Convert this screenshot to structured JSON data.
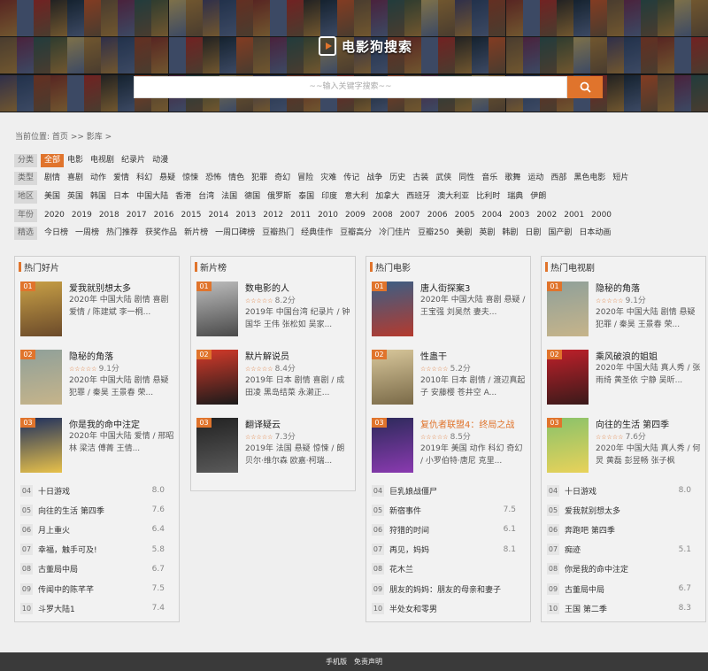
{
  "header": {
    "logo_text": "电影狗搜索",
    "search_placeholder": "~~输入关键字搜索~~"
  },
  "breadcrumb": {
    "prefix": "当前位置:",
    "home": "首页",
    "sep": ">>",
    "current": "影库",
    "tail": ">"
  },
  "filters": [
    {
      "label": "分类",
      "items": [
        "全部",
        "电影",
        "电视剧",
        "纪录片",
        "动漫"
      ],
      "active": 0
    },
    {
      "label": "类型",
      "items": [
        "剧情",
        "喜剧",
        "动作",
        "爱情",
        "科幻",
        "悬疑",
        "惊悚",
        "恐怖",
        "情色",
        "犯罪",
        "奇幻",
        "冒险",
        "灾难",
        "传记",
        "战争",
        "历史",
        "古装",
        "武侠",
        "同性",
        "音乐",
        "歌舞",
        "运动",
        "西部",
        "黑色电影",
        "短片"
      ],
      "active": -1
    },
    {
      "label": "地区",
      "items": [
        "美国",
        "英国",
        "韩国",
        "日本",
        "中国大陆",
        "香港",
        "台湾",
        "法国",
        "德国",
        "俄罗斯",
        "泰国",
        "印度",
        "意大利",
        "加拿大",
        "西班牙",
        "澳大利亚",
        "比利时",
        "瑞典",
        "伊朗"
      ],
      "active": -1
    },
    {
      "label": "年份",
      "items": [
        "2020",
        "2019",
        "2018",
        "2017",
        "2016",
        "2015",
        "2014",
        "2013",
        "2012",
        "2011",
        "2010",
        "2009",
        "2008",
        "2007",
        "2006",
        "2005",
        "2004",
        "2003",
        "2002",
        "2001",
        "2000"
      ],
      "active": -1
    },
    {
      "label": "精选",
      "items": [
        "今日榜",
        "一周榜",
        "热门推荐",
        "获奖作品",
        "新片榜",
        "一周口碑榜",
        "豆瓣热门",
        "经典佳作",
        "豆瓣高分",
        "冷门佳片",
        "豆瓣250",
        "美剧",
        "英剧",
        "韩剧",
        "日剧",
        "国产剧",
        "日本动画"
      ],
      "active": -1
    }
  ],
  "panels": [
    {
      "title": "热门好片",
      "featured": [
        {
          "rank": "01",
          "title": "爱我就别想太多",
          "rating": "",
          "info": "2020年 中国大陆 剧情 喜剧 爱情 / 陈建斌 李一桐...",
          "poster": [
            "#c8a046",
            "#6b4a2a"
          ]
        },
        {
          "rank": "02",
          "title": "隐秘的角落",
          "rating": "9.1分",
          "info": "2020年 中国大陆 剧情 悬疑 犯罪 / 秦昊 王景春 荣...",
          "poster": [
            "#8fa09a",
            "#c6b48a"
          ]
        },
        {
          "rank": "03",
          "title": "你是我的命中注定",
          "rating": "",
          "info": "2020年 中国大陆 爱情 / 邢昭林 梁洁 傅菁 王倩...",
          "poster": [
            "#1e2f5e",
            "#e8c14a"
          ]
        }
      ],
      "list": [
        {
          "num": "04",
          "name": "十日游戏",
          "score": "8.0"
        },
        {
          "num": "05",
          "name": "向往的生活 第四季",
          "score": "7.6"
        },
        {
          "num": "06",
          "name": "月上重火",
          "score": "6.4"
        },
        {
          "num": "07",
          "name": "幸福，触手可及!",
          "score": "5.8"
        },
        {
          "num": "08",
          "name": "古董局中局",
          "score": "6.7"
        },
        {
          "num": "09",
          "name": "传闻中的陈芊芊",
          "score": "7.5"
        },
        {
          "num": "10",
          "name": "斗罗大陆1",
          "score": "7.4"
        }
      ]
    },
    {
      "title": "新片榜",
      "featured": [
        {
          "rank": "01",
          "title": "数电影的人",
          "rating": "8.2分",
          "info": "2019年 中国台湾 纪录片 / 钟国华 王伟 张松如 吴家...",
          "poster": [
            "#bdbdbd",
            "#4a4a4a"
          ]
        },
        {
          "rank": "02",
          "title": "默片解说员",
          "rating": "8.4分",
          "info": "2019年 日本 剧情 喜剧 / 成田凌 黑岛结菜 永濑正...",
          "poster": [
            "#d53a2a",
            "#1a1a1a"
          ]
        },
        {
          "rank": "03",
          "title": "翻译疑云",
          "rating": "7.3分",
          "info": "2019年 法国 悬疑 惊悚 / 朗贝尔·维尔森 欧嘉·柯瑞...",
          "poster": [
            "#222222",
            "#5a5a5a"
          ]
        }
      ],
      "list": []
    },
    {
      "title": "热门电影",
      "featured": [
        {
          "rank": "01",
          "title": "唐人街探案3",
          "rating": "",
          "info": "2020年 中国大陆 喜剧 悬疑 / 王宝强 刘昊然 妻夫...",
          "poster": [
            "#3a5f86",
            "#b43a2e"
          ]
        },
        {
          "rank": "02",
          "title": "性蛊干",
          "rating": "5.2分",
          "info": "2010年 日本 剧情 / 渡辺真起子 安藤樱 苍井空 A...",
          "poster": [
            "#d8c79b",
            "#7a6a48"
          ]
        },
        {
          "rank": "03",
          "title": "复仇者联盟4：终局之战",
          "rating": "8.5分",
          "info": "2019年 美国 动作 科幻 奇幻 / 小罗伯特·唐尼 克里...",
          "poster": [
            "#2c2a5a",
            "#8a3ab0"
          ],
          "red": true
        }
      ],
      "list": [
        {
          "num": "04",
          "name": "巨乳娘战僵尸",
          "score": ""
        },
        {
          "num": "05",
          "name": "新宿事件",
          "score": "7.5"
        },
        {
          "num": "06",
          "name": "狩猎的时间",
          "score": "6.1"
        },
        {
          "num": "07",
          "name": "再见，妈妈",
          "score": "8.1"
        },
        {
          "num": "08",
          "name": "花木兰",
          "score": ""
        },
        {
          "num": "09",
          "name": "朋友的妈妈：朋友的母亲和妻子",
          "score": ""
        },
        {
          "num": "10",
          "name": "半处女和零男",
          "score": ""
        }
      ]
    },
    {
      "title": "热门电视剧",
      "featured": [
        {
          "rank": "01",
          "title": "隐秘的角落",
          "rating": "9.1分",
          "info": "2020年 中国大陆 剧情 悬疑 犯罪 / 秦昊 王景春 荣...",
          "poster": [
            "#8fa09a",
            "#c6b48a"
          ]
        },
        {
          "rank": "02",
          "title": "乘风破浪的姐姐",
          "rating": "",
          "info": "2020年 中国大陆 真人秀 / 张雨绮 黄圣依 宁静 吴昕...",
          "poster": [
            "#c0202a",
            "#3a1a1a"
          ]
        },
        {
          "rank": "03",
          "title": "向往的生活 第四季",
          "rating": "7.6分",
          "info": "2020年 中国大陆 真人秀 / 何炅 黄磊 彭昱畅 张子枫",
          "poster": [
            "#8ac26a",
            "#e8d25a"
          ]
        }
      ],
      "list": [
        {
          "num": "04",
          "name": "十日游戏",
          "score": "8.0"
        },
        {
          "num": "05",
          "name": "爱我就别想太多",
          "score": ""
        },
        {
          "num": "06",
          "name": "奔跑吧 第四季",
          "score": ""
        },
        {
          "num": "07",
          "name": "痴迹",
          "score": "5.1"
        },
        {
          "num": "08",
          "name": "你是我的命中注定",
          "score": ""
        },
        {
          "num": "09",
          "name": "古董局中局",
          "score": "6.7"
        },
        {
          "num": "10",
          "name": "王国 第二季",
          "score": "8.3"
        }
      ]
    }
  ],
  "footer": {
    "links": [
      "手机版",
      "免责声明"
    ]
  },
  "colors": {
    "accent": "#e0742c",
    "footer_bg": "#3a3a3a",
    "page_bg": "#efefef"
  },
  "icons": {
    "search": "search-icon",
    "logo": "logo-icon",
    "stars": "star-rating-icon"
  }
}
